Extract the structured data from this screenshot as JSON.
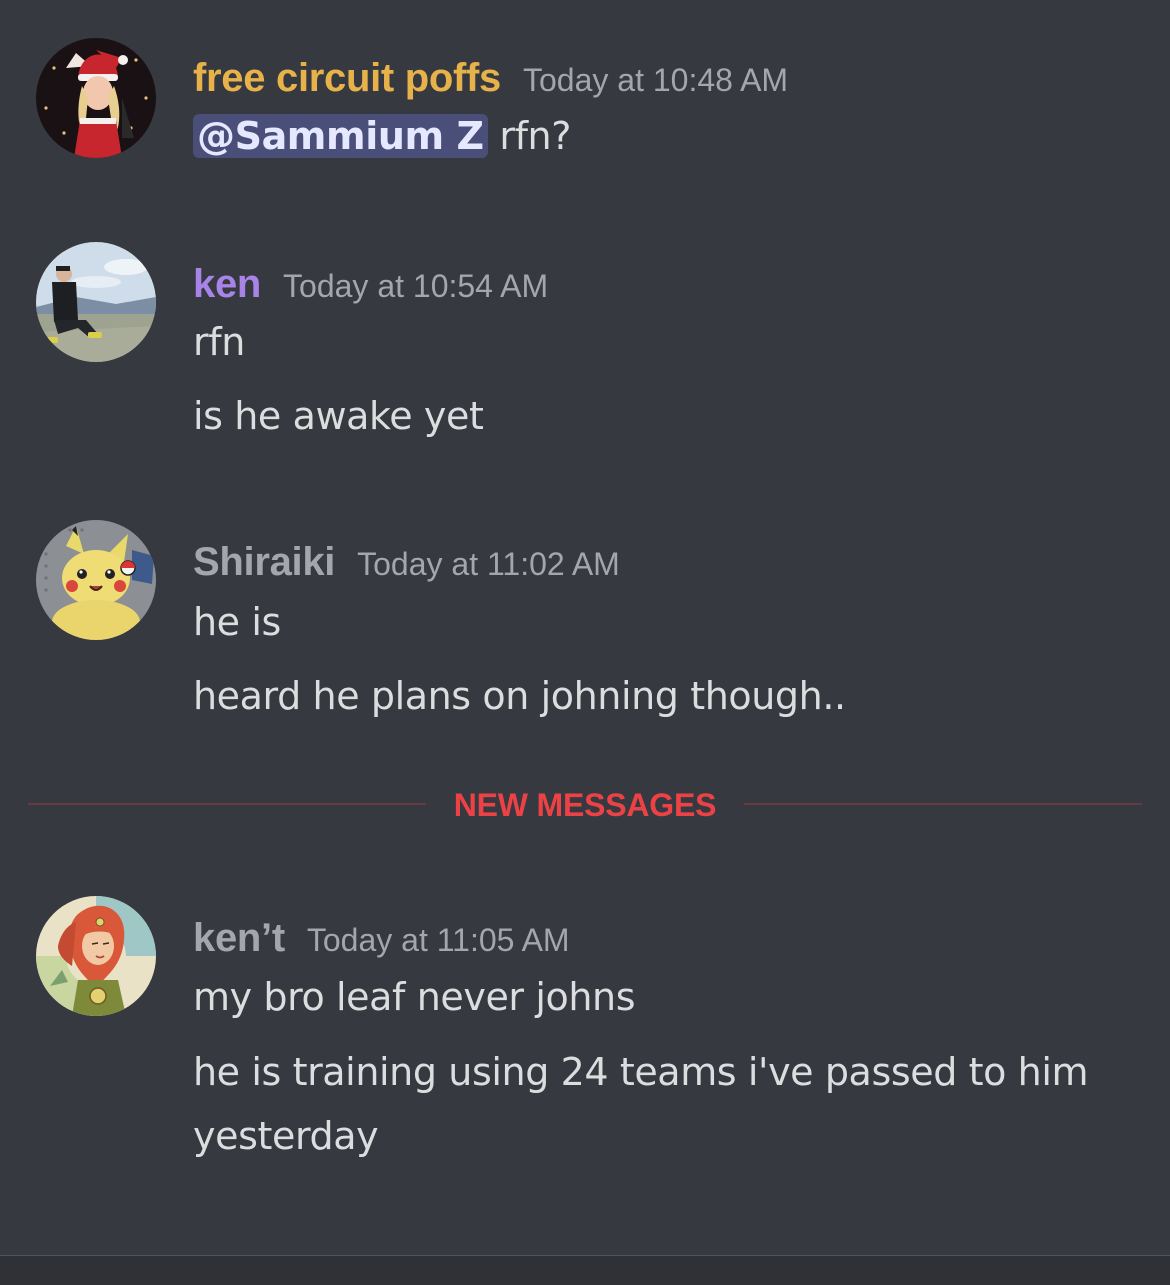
{
  "messages": [
    {
      "username": "free circuit poffs",
      "username_color": "#e8b24a",
      "timestamp": "Today at 10:48 AM",
      "avatar_icon": "santa-hat-girl-avatar",
      "lines": [
        {
          "mention": "@Sammium Z",
          "text": " rfn?"
        }
      ]
    },
    {
      "username": "ken",
      "username_color": "#a884e8",
      "timestamp": "Today at 10:54 AM",
      "avatar_icon": "mountain-hiker-avatar",
      "lines": [
        {
          "text": "rfn"
        },
        {
          "text": "is he awake yet"
        }
      ]
    },
    {
      "username": "Shiraiki",
      "username_color": "#a3a6aa",
      "timestamp": "Today at 11:02 AM",
      "avatar_icon": "pikachu-plush-avatar",
      "lines": [
        {
          "text": "he is"
        },
        {
          "text": "heard he plans on johning though.."
        }
      ]
    },
    {
      "username": "ken’t",
      "username_color": "#a3a6aa",
      "timestamp": "Today at 11:05 AM",
      "avatar_icon": "red-hair-girl-avatar",
      "lines": [
        {
          "text": "my bro leaf never johns"
        },
        {
          "text": "he is training using 24 teams i've passed to him yesterday"
        }
      ]
    }
  ],
  "divider": {
    "label": "NEW MESSAGES",
    "color": "#ed4245"
  },
  "colors": {
    "background": "#36393f",
    "timestamp": "#a3a6aa",
    "mention_bg": "#4a4f7a"
  }
}
